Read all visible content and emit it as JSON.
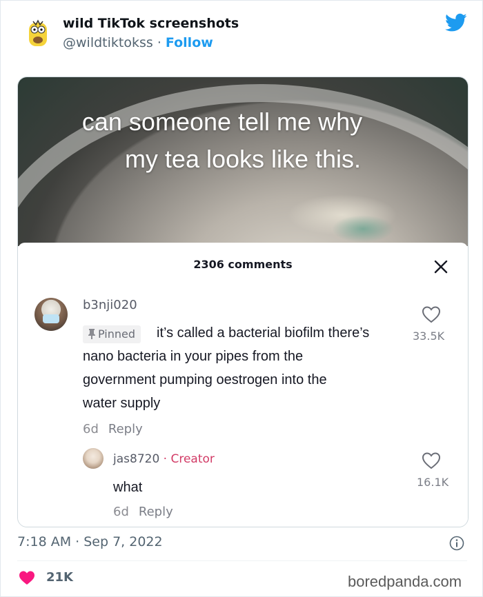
{
  "tweet": {
    "display_name": "wild TikTok screenshots",
    "handle": "@wildtiktokss",
    "separator": "·",
    "follow_label": "Follow",
    "timestamp": "7:18 AM · Sep 7, 2022",
    "likes": "21K",
    "colors": {
      "accent": "#1d9bf0",
      "like": "#f91880"
    },
    "icons": [
      "twitter-bird-icon",
      "info-icon",
      "heart-icon"
    ]
  },
  "tiktok": {
    "caption_line1": "can someone tell me why",
    "caption_line2": "my tea looks like this.",
    "comments_count": "2306 comments",
    "comment": {
      "username": "b3nji020",
      "pinned_label": "Pinned",
      "lines": [
        "it’s called a bacterial biofilm there’s",
        "nano bacteria in your pipes from the",
        "government pumping oestrogen into the",
        "water supply"
      ],
      "likes": "33.5K",
      "age": "6d",
      "reply_label": "Reply"
    },
    "reply": {
      "username": "jas8720",
      "creator_label": "· Creator",
      "text": "what",
      "likes": "16.1K",
      "age": "6d",
      "reply_label": "Reply"
    },
    "colors": {
      "creator": "#d23b66"
    }
  },
  "watermark": "boredpanda.com"
}
